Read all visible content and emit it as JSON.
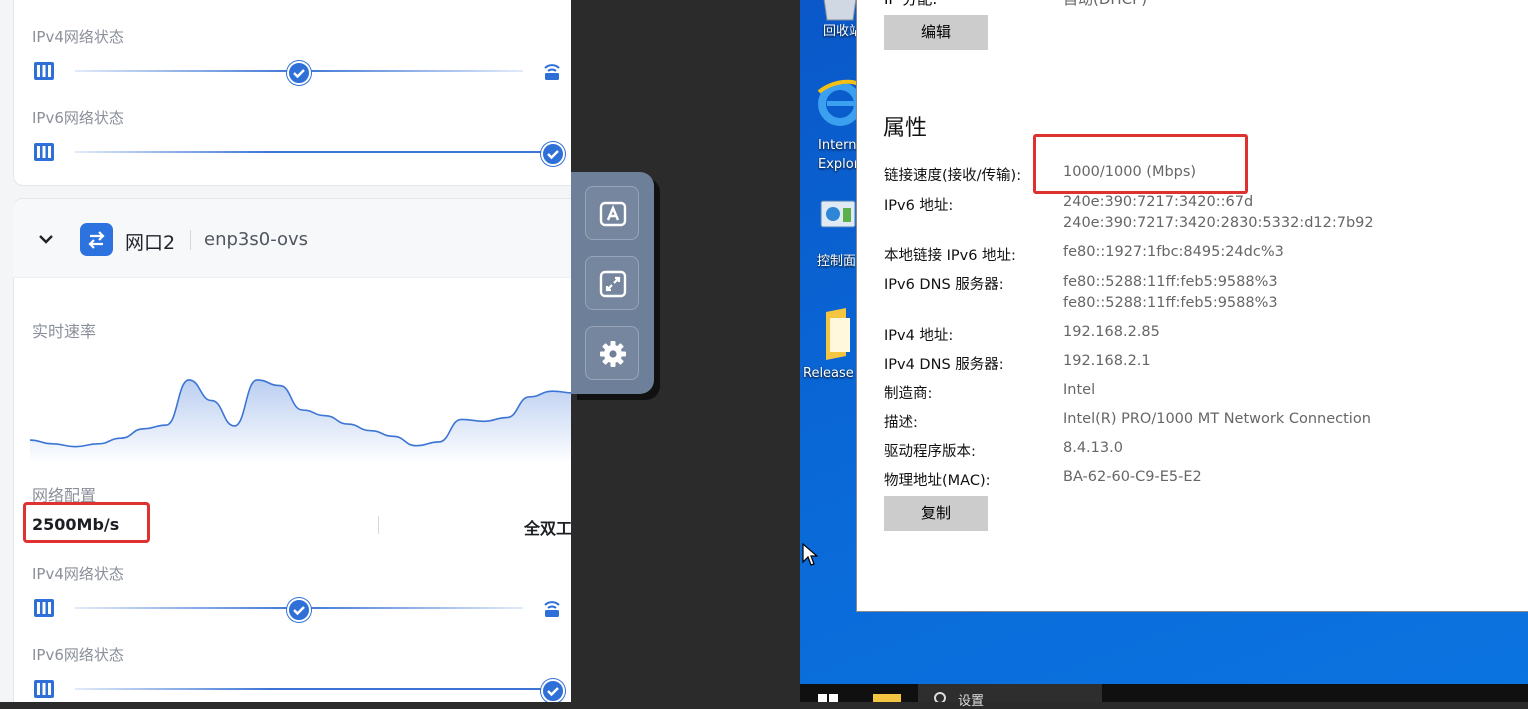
{
  "left_panel": {
    "port1": {
      "ipv4_status_label": "IPv4网络状态",
      "ipv6_status_label": "IPv6网络状态"
    },
    "port2": {
      "name": "网口2",
      "interface": "enp3s0-ovs",
      "realtime_rate_label": "实时速率",
      "network_config_label": "网络配置",
      "speed": "2500Mb/s",
      "duplex": "全双工",
      "ipv4_status_label": "IPv4网络状态",
      "ipv6_status_label": "IPv6网络状态",
      "rate_series": [
        18,
        14,
        11,
        14,
        20,
        30,
        34,
        82,
        60,
        33,
        82,
        76,
        50,
        44,
        35,
        28,
        22,
        12,
        16,
        40,
        38,
        42,
        64,
        70,
        68
      ]
    }
  },
  "toolbar": {
    "icons": [
      "text-a-icon",
      "expand-icon",
      "gear-icon"
    ]
  },
  "desktop": {
    "icons": [
      {
        "label": "回收站",
        "icon": "recycle-bin-icon"
      },
      {
        "label": "Internet Explorer",
        "icon": "ie-icon"
      },
      {
        "label": "控制面板",
        "icon": "control-panel-icon"
      },
      {
        "label": "Release",
        "icon": "folder-icon"
      }
    ],
    "taskbar": {
      "settings_label": "设置"
    }
  },
  "settings": {
    "ip_assign_label": "IP 分配:",
    "ip_assign_value": "自动(DHCP)",
    "edit_button": "编辑",
    "properties_title": "属性",
    "properties": [
      {
        "key": "链接速度(接收/传输):",
        "value": "1000/1000 (Mbps)"
      },
      {
        "key": "IPv6 地址:",
        "value": "240e:390:7217:3420::67d",
        "value2": "240e:390:7217:3420:2830:5332:d12:7b92"
      },
      {
        "key": "本地链接 IPv6 地址:",
        "value": "fe80::1927:1fbc:8495:24dc%3"
      },
      {
        "key": "IPv6 DNS 服务器:",
        "value": "fe80::5288:11ff:feb5:9588%3",
        "value2": "fe80::5288:11ff:feb5:9588%3"
      },
      {
        "key": "IPv4 地址:",
        "value": "192.168.2.85"
      },
      {
        "key": "IPv4 DNS 服务器:",
        "value": "192.168.2.1"
      },
      {
        "key": "制造商:",
        "value": "Intel"
      },
      {
        "key": "描述:",
        "value": "Intel(R) PRO/1000 MT Network Connection"
      },
      {
        "key": "驱动程序版本:",
        "value": "8.4.13.0"
      },
      {
        "key": "物理地址(MAC):",
        "value": "BA-62-60-C9-E5-E2"
      }
    ],
    "copy_button": "复制"
  }
}
